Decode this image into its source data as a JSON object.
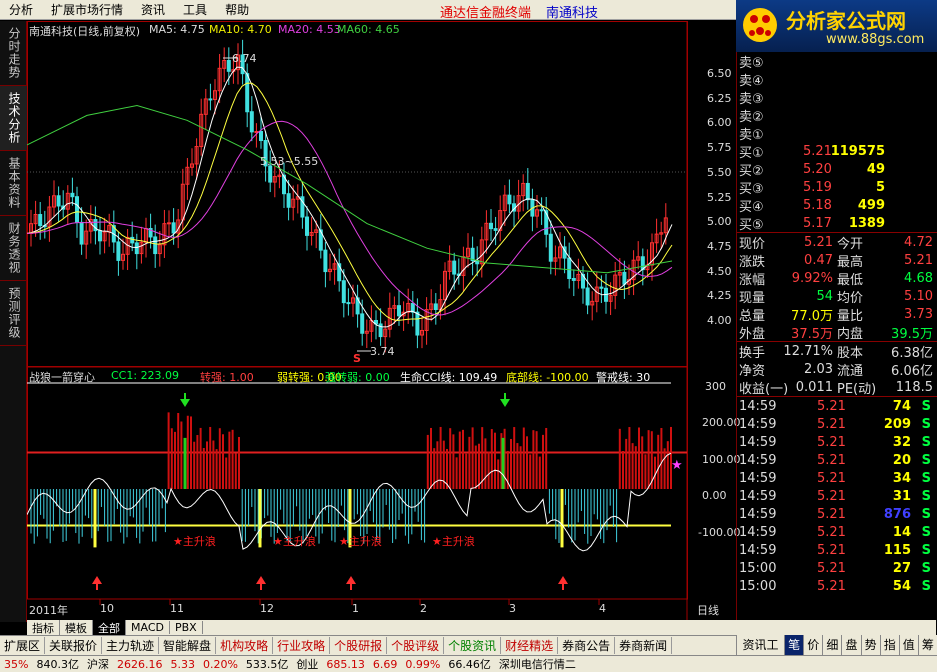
{
  "menu": [
    "分析",
    "扩展市场行情",
    "资讯",
    "工具",
    "帮助"
  ],
  "menu_center": "通达信金融终端",
  "menu_stock": "南通科技",
  "logo": {
    "title": "分析家公式网",
    "url": "www.88gs.com"
  },
  "left_tabs": [
    "分时走势",
    "技术分析",
    "基本资料",
    "财务透视",
    "预测评级"
  ],
  "main_header": {
    "title": "南通科技(日线,前复权)",
    "ma5": "MA5: 4.75",
    "ma10": "MA10: 4.70",
    "ma20": "MA20: 4.53",
    "ma60": "MA60: 4.65"
  },
  "price_axis": [
    "6.50",
    "6.25",
    "6.00",
    "5.75",
    "5.50",
    "5.25",
    "5.00",
    "4.75",
    "4.50",
    "4.25",
    "4.00"
  ],
  "annotations": {
    "high": "6.74",
    "low": "3.74",
    "range": "5.53~5.55",
    "s_mark": "S"
  },
  "indicator_header": {
    "name": "战狼一箭穿心",
    "cc1": "CC1: 223.09",
    "zhuanqiang": "转强: 1.00",
    "ruozhuanqiang": "弱转强: 0.00",
    "qiangzhuanruo": "强转弱: 0.00",
    "shengming": "生命CCI线: 109.49",
    "dibu": "底部线: -100.00",
    "jingjie": "警戒线: 30"
  },
  "ind_axis": [
    "300",
    "200.00",
    "100.00",
    "0.00",
    "-100.00"
  ],
  "zhushengliang_label": "主升浪",
  "date_axis": [
    "2011年",
    "10",
    "11",
    "12",
    "1",
    "2",
    "3",
    "4"
  ],
  "period_label": "日线",
  "order_book": {
    "sell": [
      {
        "label": "卖⑤"
      },
      {
        "label": "卖④"
      },
      {
        "label": "卖③"
      },
      {
        "label": "卖②"
      },
      {
        "label": "卖①"
      }
    ],
    "buy": [
      {
        "label": "买①",
        "price": "5.21",
        "vol": "119575"
      },
      {
        "label": "买②",
        "price": "5.20",
        "vol": "49"
      },
      {
        "label": "买③",
        "price": "5.19",
        "vol": "5"
      },
      {
        "label": "买④",
        "price": "5.18",
        "vol": "499"
      },
      {
        "label": "买⑤",
        "price": "5.17",
        "vol": "1389"
      }
    ]
  },
  "quote": [
    {
      "k1": "现价",
      "v1": "5.21",
      "k2": "今开",
      "v2": "4.72"
    },
    {
      "k1": "涨跌",
      "v1": "0.47",
      "k2": "最高",
      "v2": "5.21"
    },
    {
      "k1": "涨幅",
      "v1": "9.92%",
      "k2": "最低",
      "v2": "4.68"
    },
    {
      "k1": "现量",
      "v1": "54",
      "k2": "均价",
      "v2": "5.10"
    },
    {
      "k1": "总量",
      "v1": "77.0万",
      "k2": "量比",
      "v2": "3.73"
    },
    {
      "k1": "外盘",
      "v1": "37.5万",
      "k2": "内盘",
      "v2": "39.5万"
    }
  ],
  "stats": [
    {
      "k1": "换手",
      "v1": "12.71%",
      "k2": "股本",
      "v2": "6.38亿"
    },
    {
      "k1": "净资",
      "v1": "2.03",
      "k2": "流通",
      "v2": "6.06亿"
    },
    {
      "k1": "收益(一)",
      "v1": "0.011",
      "k2": "PE(动)",
      "v2": "118.5"
    }
  ],
  "ticks": [
    {
      "t": "14:59",
      "p": "5.21",
      "v": "74",
      "s": "S"
    },
    {
      "t": "14:59",
      "p": "5.21",
      "v": "209",
      "s": "S"
    },
    {
      "t": "14:59",
      "p": "5.21",
      "v": "32",
      "s": "S"
    },
    {
      "t": "14:59",
      "p": "5.21",
      "v": "20",
      "s": "S"
    },
    {
      "t": "14:59",
      "p": "5.21",
      "v": "34",
      "s": "S"
    },
    {
      "t": "14:59",
      "p": "5.21",
      "v": "31",
      "s": "S"
    },
    {
      "t": "14:59",
      "p": "5.21",
      "v": "876",
      "s": "S"
    },
    {
      "t": "14:59",
      "p": "5.21",
      "v": "14",
      "s": "S"
    },
    {
      "t": "14:59",
      "p": "5.21",
      "v": "115",
      "s": "S"
    },
    {
      "t": "15:00",
      "p": "5.21",
      "v": "27",
      "s": "S"
    },
    {
      "t": "15:00",
      "p": "5.21",
      "v": "54",
      "s": "S"
    }
  ],
  "tab_strip": [
    "指标",
    "模板",
    "全部",
    "MACD",
    "PBX"
  ],
  "func_bar": [
    "扩展区",
    "关联报价",
    "主力轨迹",
    "智能解盘",
    "机构攻略",
    "行业攻略",
    "个股研报",
    "个股评级",
    "个股资讯",
    "财经精选",
    "券商公告",
    "券商新闻",
    "资讯工场"
  ],
  "right_buttons": [
    "笔",
    "价",
    "细",
    "盘",
    "势",
    "指",
    "值",
    "筹"
  ],
  "status": [
    "35%",
    "840.3亿",
    "沪深",
    "2626.16",
    "5.33",
    "0.20%",
    "533.5亿",
    "创业",
    "685.13",
    "6.69",
    "0.99%",
    "66.46亿",
    "深圳电信行情二"
  ]
}
